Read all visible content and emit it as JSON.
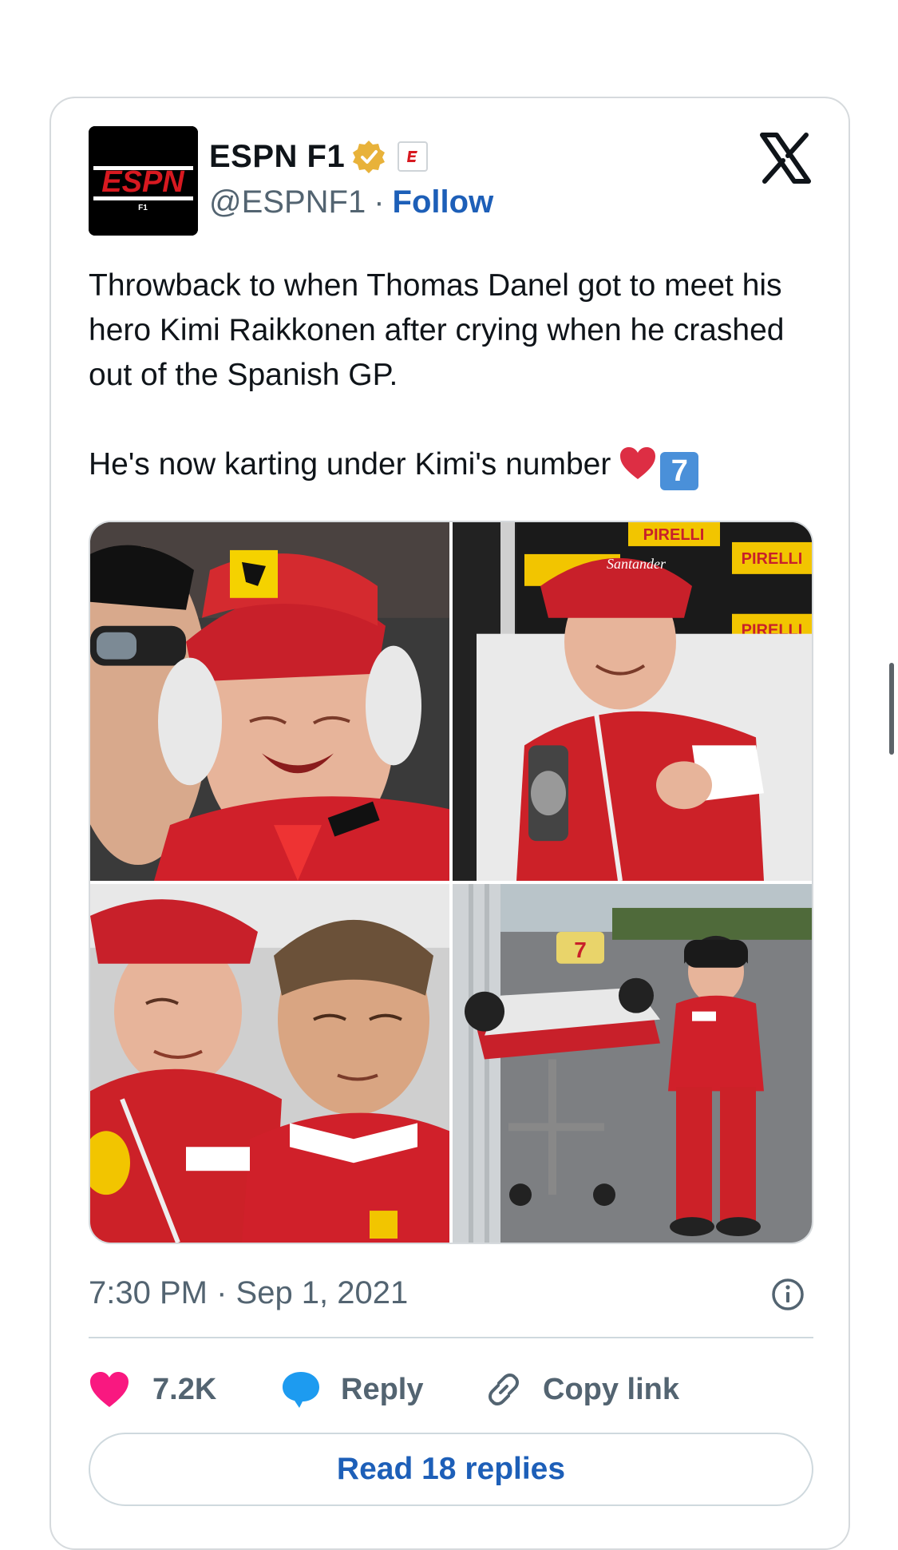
{
  "author": {
    "name": "ESPN F1",
    "handle": "@ESPNF1",
    "separator": "·",
    "follow_label": "Follow",
    "avatar_text": "ESPN",
    "avatar_subtext": "F1"
  },
  "tweet": {
    "text": "Throwback to when Thomas Danel got to meet his hero Kimi Raikkonen after crying when he crashed out of the Spanish GP.\n\nHe's now karting under Kimi's number",
    "emoji_number": "7",
    "timestamp": "7:30 PM · Sep 1, 2021"
  },
  "media": {
    "photo_texts": {
      "pirelli": "PIRELLI",
      "santander": "Santander",
      "kart_number": "7"
    }
  },
  "actions": {
    "likes": "7.2K",
    "reply_label": "Reply",
    "copy_label": "Copy link",
    "read_replies": "Read 18 replies"
  },
  "colors": {
    "link": "#1d5fb8",
    "like": "#f91880",
    "reply": "#1d9bf0",
    "muted": "#536471",
    "border": "#d6dadd"
  },
  "icons": [
    "verified-badge-icon",
    "espn-affiliate-icon",
    "x-logo-icon",
    "heart-icon",
    "reply-bubble-icon",
    "link-icon",
    "info-icon"
  ]
}
